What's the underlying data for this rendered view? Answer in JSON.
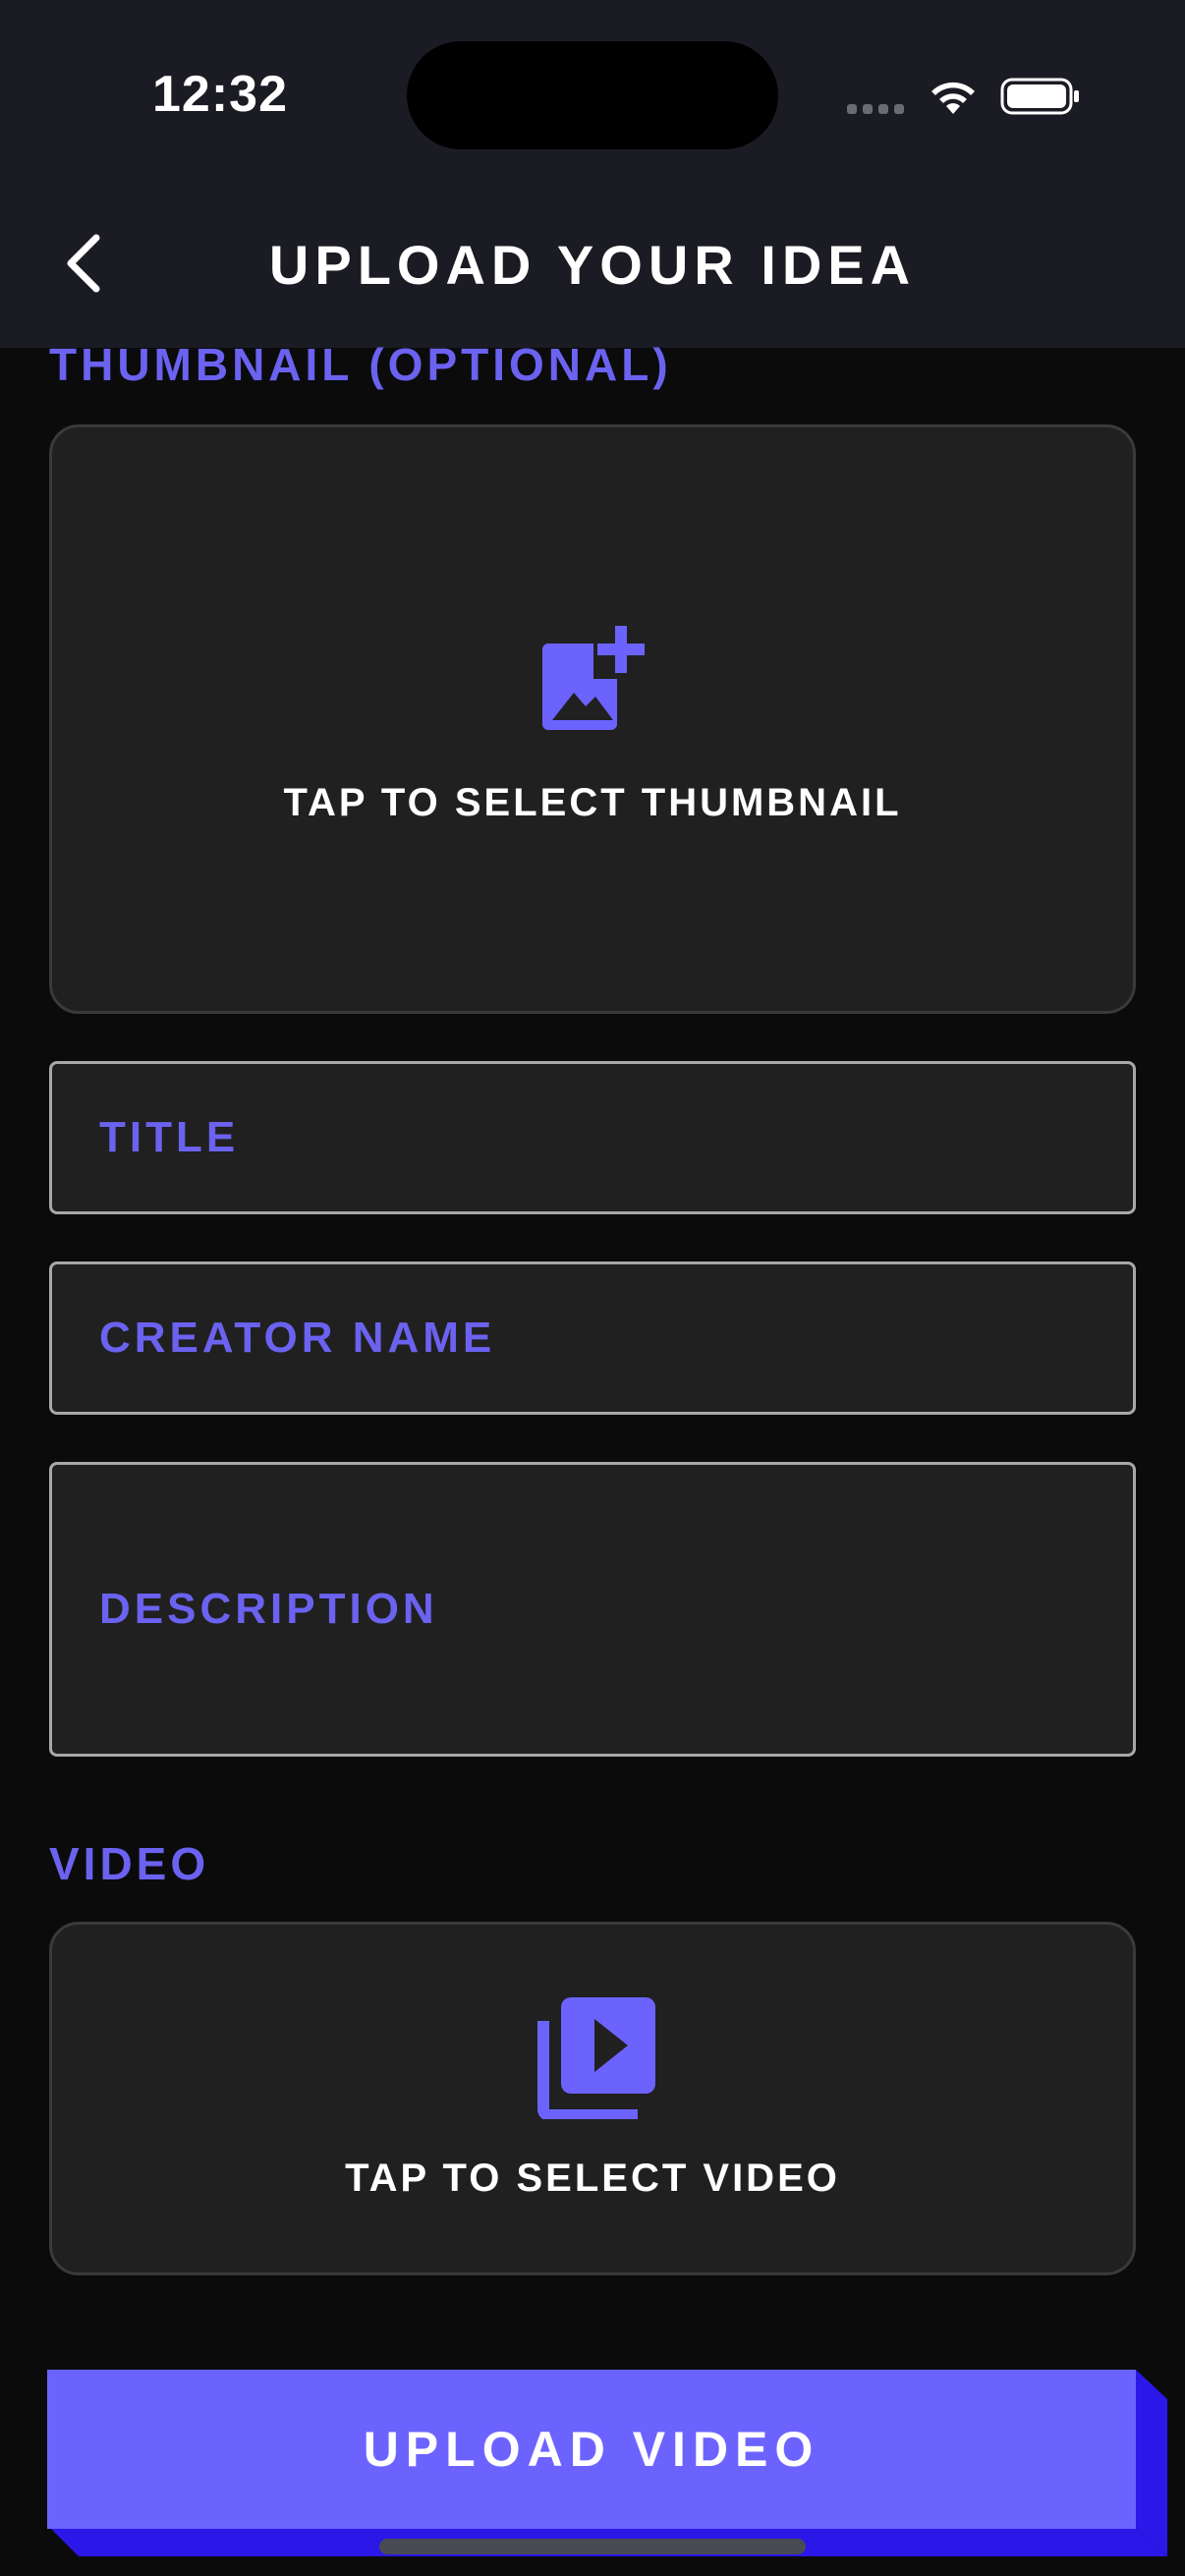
{
  "status_bar": {
    "time": "12:32"
  },
  "header": {
    "title": "UPLOAD YOUR IDEA",
    "back_icon": "chevron-left-icon"
  },
  "thumbnail": {
    "section_label": "THUMBNAIL (OPTIONAL)",
    "prompt": "TAP TO SELECT THUMBNAIL",
    "icon": "add-photo-icon"
  },
  "form": {
    "title_placeholder": "TITLE",
    "creator_placeholder": "CREATOR NAME",
    "description_placeholder": "DESCRIPTION"
  },
  "video": {
    "section_label": "VIDEO",
    "prompt": "TAP TO SELECT VIDEO",
    "icon": "video-library-icon"
  },
  "actions": {
    "upload_label": "UPLOAD VIDEO"
  },
  "colors": {
    "accent": "#6c63ff",
    "label": "#6b62f0",
    "background": "#0b0b0c",
    "header_bg": "#1b1b24"
  }
}
